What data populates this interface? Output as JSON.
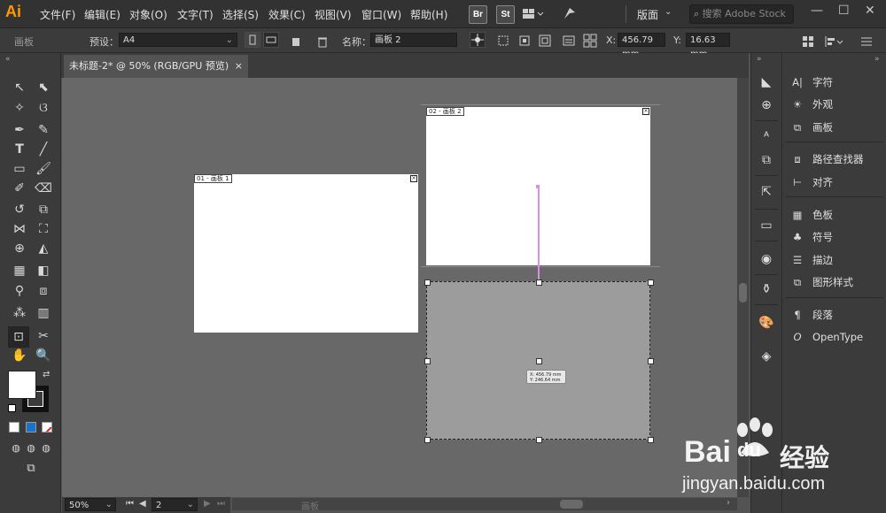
{
  "app": {
    "logo": "Ai"
  },
  "menu": [
    "文件(F)",
    "编辑(E)",
    "对象(O)",
    "文字(T)",
    "选择(S)",
    "效果(C)",
    "视图(V)",
    "窗口(W)",
    "帮助(H)"
  ],
  "appbar": {
    "bridge": "Br",
    "stock": "St",
    "workspace": "版面",
    "search_placeholder": "搜索 Adobe Stock"
  },
  "control": {
    "panel_name": "画板",
    "preset_label": "预设：",
    "preset_value": "A4",
    "name_label": "名称：",
    "name_value": "画板 2",
    "x_label": "X:",
    "x_value": "456.79 mm",
    "y_label": "Y:",
    "y_value": "16.63 mm"
  },
  "document": {
    "tab_title": "未标题-2* @ 50% (RGB/GPU 预览)",
    "close": "×"
  },
  "artboards": [
    {
      "label": "01 - 画板 1"
    },
    {
      "label": "02 - 画板 2"
    }
  ],
  "tooltip": {
    "x": "X: 456.79 mm",
    "y": "Y: 246.64 mm"
  },
  "status": {
    "zoom": "50%",
    "page": "2",
    "tool_name": "画板"
  },
  "panels": [
    {
      "icon": "character-icon",
      "label": "字符"
    },
    {
      "icon": "appearance-icon",
      "label": "外观"
    },
    {
      "icon": "artboards-icon",
      "label": "画板"
    },
    {
      "icon": "pathfinder-icon",
      "label": "路径查找器"
    },
    {
      "icon": "align-icon",
      "label": "对齐"
    },
    {
      "icon": "swatches-icon",
      "label": "色板"
    },
    {
      "icon": "symbols-icon",
      "label": "符号"
    },
    {
      "icon": "stroke-icon",
      "label": "描边"
    },
    {
      "icon": "graphic-styles-icon",
      "label": "图形样式"
    },
    {
      "icon": "paragraph-icon",
      "label": "段落"
    },
    {
      "icon": "opentype-icon",
      "label": "OpenType"
    }
  ],
  "watermark": {
    "brand": "Bai",
    "brand2": "du",
    "cn": "经验",
    "url": "jingyan.baidu.com"
  },
  "colors": {
    "accent": "#ff9a00",
    "guide": "#d98fe3",
    "selected_artboard_fill": "#9c9c9c"
  }
}
